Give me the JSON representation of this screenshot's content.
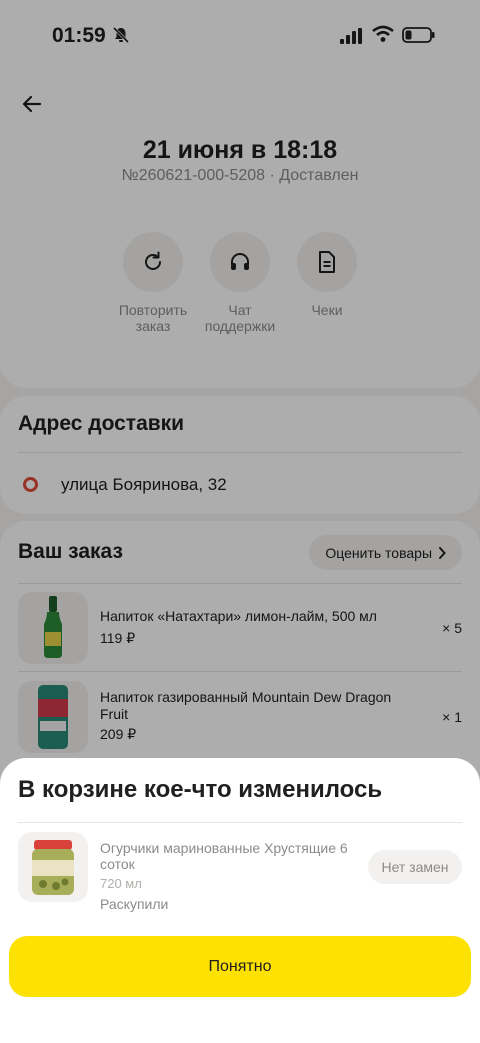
{
  "status": {
    "time": "01:59"
  },
  "header": {
    "title": "21 июня в 18:18",
    "subtitle": "№260621-000-5208 · Доставлен",
    "actions": [
      {
        "label": "Повторить заказ",
        "icon": "repeat-icon"
      },
      {
        "label": "Чат поддержки",
        "icon": "headset-icon"
      },
      {
        "label": "Чеки",
        "icon": "receipt-icon"
      }
    ]
  },
  "address": {
    "title": "Адрес доставки",
    "text": "улица Бояринова, 32"
  },
  "order": {
    "title": "Ваш заказ",
    "rate_label": "Оценить товары",
    "items": [
      {
        "name": "Напиток «Натахтари» лимон-лайм, 500 мл",
        "price": "119 ₽",
        "qty": "× 5"
      },
      {
        "name": "Напиток газированный Mountain Dew Dragon Fruit",
        "price": "209 ₽",
        "qty": "× 1"
      }
    ]
  },
  "sheet": {
    "title": "В корзине кое-что изменилось",
    "item": {
      "name": "Огурчики маринованные Хрустящие 6 соток",
      "weight": "720 мл",
      "status": "Раскупили",
      "action": "Нет замен"
    },
    "confirm": "Понятно"
  },
  "colors": {
    "accent": "#fde100",
    "address_dot": "#e04b3a"
  }
}
